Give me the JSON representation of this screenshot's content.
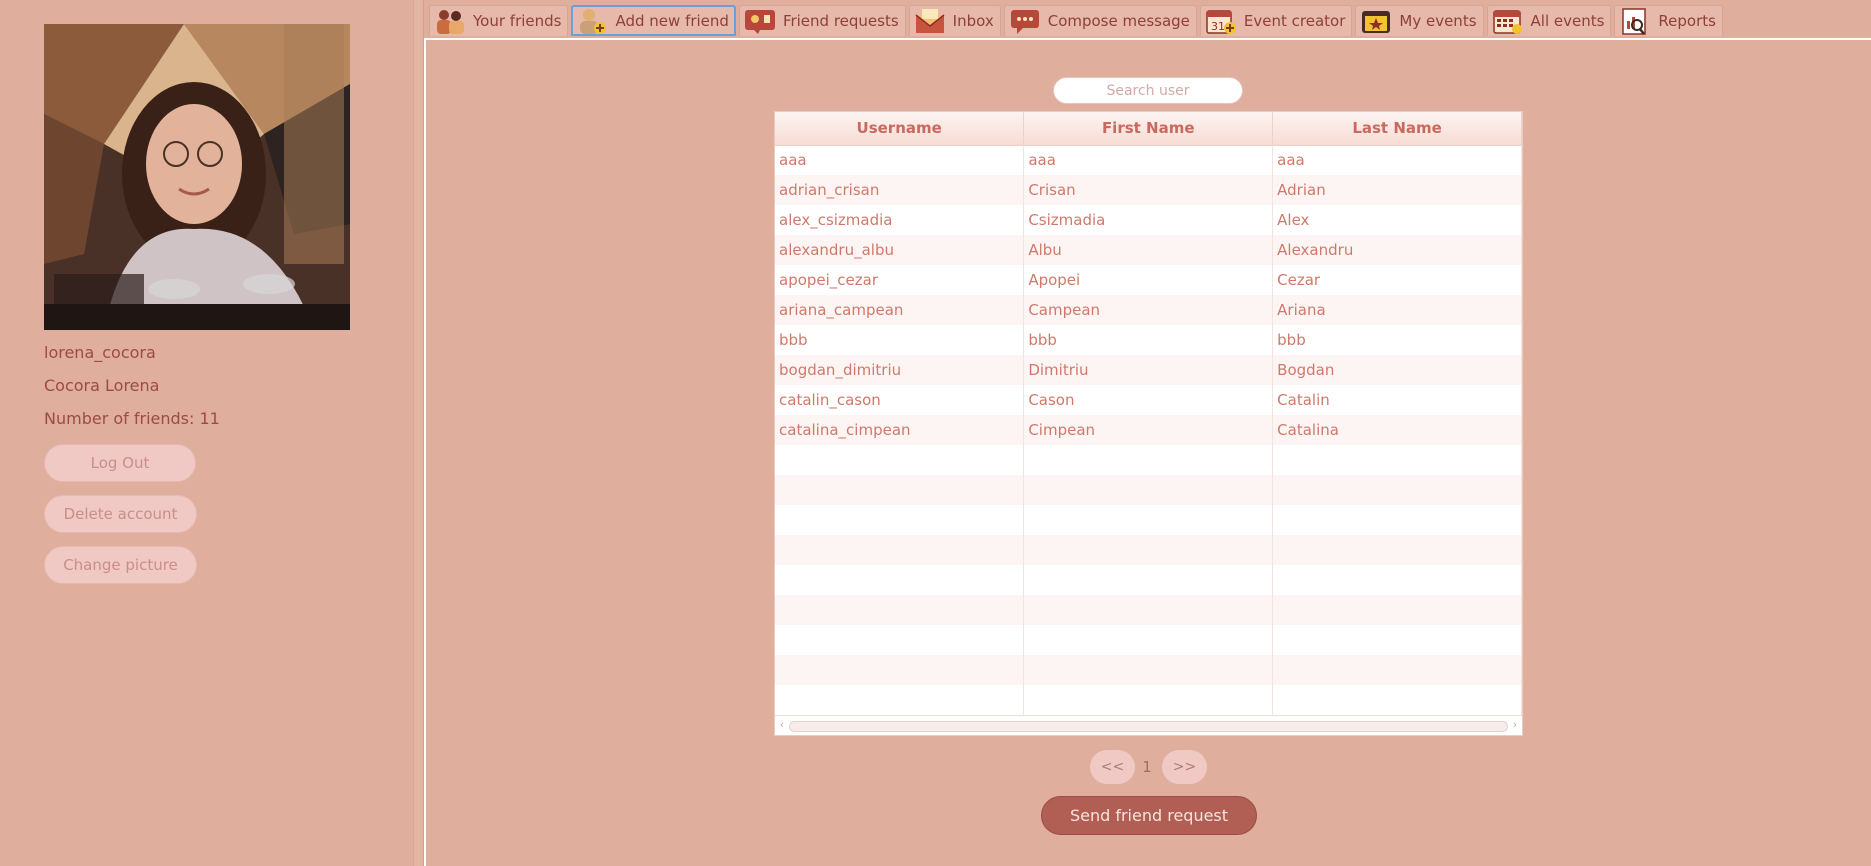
{
  "profile": {
    "username": "lorena_cocora",
    "full_name": "Cocora Lorena",
    "friends_count_label": "Number of friends: 11",
    "buttons": {
      "logout": "Log Out",
      "delete_account": "Delete account",
      "change_picture": "Change picture"
    }
  },
  "tabs": [
    {
      "label": "Your friends",
      "icon": "friends-icon"
    },
    {
      "label": "Add new friend",
      "icon": "add-friend-icon",
      "active": true
    },
    {
      "label": "Friend requests",
      "icon": "friend-requests-icon"
    },
    {
      "label": "Inbox",
      "icon": "inbox-icon"
    },
    {
      "label": "Compose message",
      "icon": "compose-icon"
    },
    {
      "label": "Event creator",
      "icon": "calendar-add-icon"
    },
    {
      "label": "My events",
      "icon": "star-calendar-icon"
    },
    {
      "label": "All events",
      "icon": "calendar-grid-icon"
    },
    {
      "label": "Reports",
      "icon": "report-icon"
    }
  ],
  "search": {
    "placeholder": "Search user",
    "value": ""
  },
  "table": {
    "columns": [
      "Username",
      "First Name",
      "Last Name"
    ],
    "rows": [
      [
        "aaa",
        "aaa",
        "aaa"
      ],
      [
        "adrian_crisan",
        "Crisan",
        "Adrian"
      ],
      [
        "alex_csizmadia",
        "Csizmadia",
        "Alex"
      ],
      [
        "alexandru_albu",
        "Albu",
        "Alexandru"
      ],
      [
        "apopei_cezar",
        "Apopei",
        "Cezar"
      ],
      [
        "ariana_campean",
        "Campean",
        "Ariana"
      ],
      [
        "bbb",
        "bbb",
        "bbb"
      ],
      [
        "bogdan_dimitriu",
        "Dimitriu",
        "Bogdan"
      ],
      [
        "catalin_cason",
        "Cason",
        "Catalin"
      ],
      [
        "catalina_cimpean",
        "Cimpean",
        "Catalina"
      ]
    ]
  },
  "pagination": {
    "prev": "<<",
    "page": "1",
    "next": ">>"
  },
  "actions": {
    "send_request": "Send friend request"
  },
  "colors": {
    "background": "#dfae9c",
    "text": "#9a4b43",
    "cell_text": "#d0796b",
    "header_text": "#c86a5e",
    "primary_button": "#b15f54",
    "soft_button": "#f1c9c4",
    "active_tab_border": "#6aa0d6"
  }
}
